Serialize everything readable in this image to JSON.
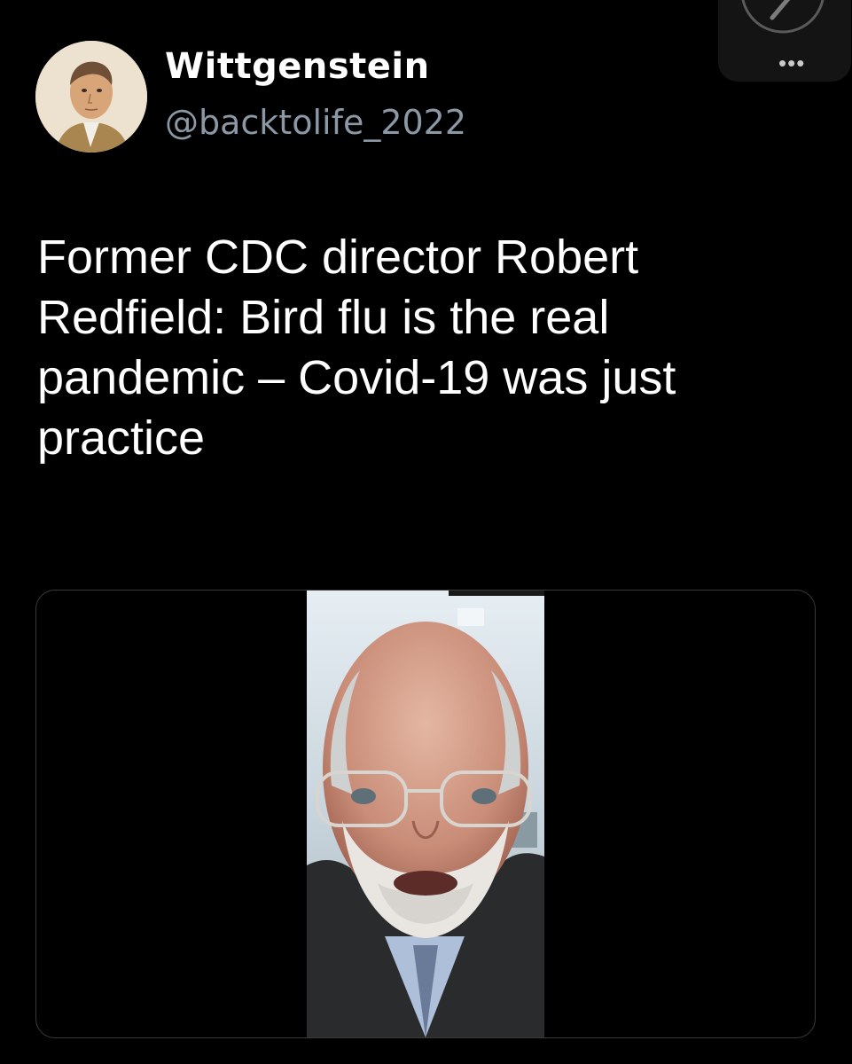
{
  "author": {
    "name": "Wittgenstein",
    "handle": "@backtolife_2022",
    "avatar_icon": "portrait-avatar"
  },
  "tweet": {
    "text": "Former CDC director Robert Redfield: Bird flu is the real pandemic – Covid-19 was just practice"
  },
  "overlay": {
    "next_icon": "chevron-right-icon",
    "more_label": "•••"
  },
  "media": {
    "type": "video",
    "icon": "video-thumbnail"
  },
  "colors": {
    "background": "#000000",
    "text": "#ffffff",
    "handle": "#8b98a5",
    "card_border": "#3a3a3a"
  }
}
